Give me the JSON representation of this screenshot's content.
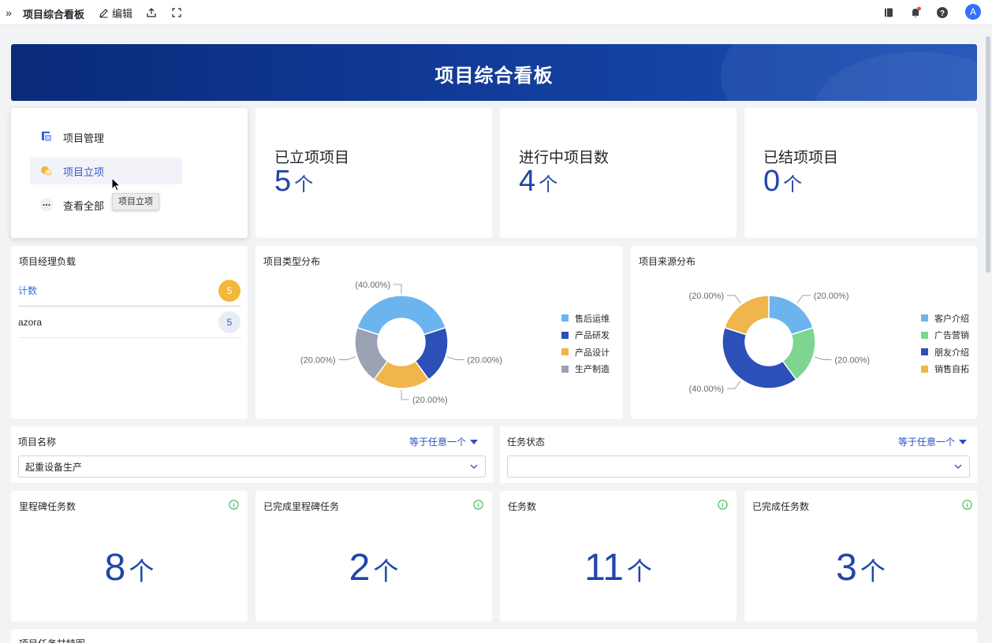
{
  "topbar": {
    "title": "项目综合看板",
    "edit_label": "编辑",
    "avatar_letter": "A"
  },
  "banner": {
    "title": "项目综合看板"
  },
  "nav": {
    "items": [
      {
        "label": "项目管理",
        "icon": "project-manage-icon"
      },
      {
        "label": "项目立项",
        "icon": "project-initiate-icon"
      },
      {
        "label": "查看全部",
        "icon": "more-icon"
      }
    ],
    "tooltip": "项目立项"
  },
  "stats": [
    {
      "label": "已立项项目",
      "value": "5",
      "unit": "个"
    },
    {
      "label": "进行中项目数",
      "value": "4",
      "unit": "个"
    },
    {
      "label": "已结项项目",
      "value": "0",
      "unit": "个"
    }
  ],
  "manager_load": {
    "title": "项目经理负载",
    "rows": [
      {
        "name": "计数",
        "count": "5"
      },
      {
        "name": "azora",
        "count": "5"
      }
    ]
  },
  "type_dist": {
    "title": "项目类型分布"
  },
  "source_dist": {
    "title": "项目来源分布"
  },
  "chart_data": [
    {
      "type": "pie",
      "title": "项目类型分布",
      "categories": [
        "售后运维",
        "产品研发",
        "产品设计",
        "生产制造"
      ],
      "values": [
        40,
        20,
        20,
        20
      ],
      "labels": [
        "(40.00%)",
        "(20.00%)",
        "(20.00%)",
        "(20.00%)"
      ],
      "colors": [
        "#6cb4ee",
        "#2c4fb8",
        "#f0b54c",
        "#9aa2b4"
      ],
      "legend": "right",
      "donut": true
    },
    {
      "type": "pie",
      "title": "项目来源分布",
      "categories": [
        "客户介绍",
        "广告营销",
        "朋友介绍",
        "销售自拓"
      ],
      "values": [
        20,
        20,
        40,
        20
      ],
      "labels": [
        "(20.00%)",
        "(20.00%)",
        "(40.00%)",
        "(20.00%)"
      ],
      "colors": [
        "#6cb4ee",
        "#7dd58f",
        "#2c4fb8",
        "#f0b54c"
      ],
      "legend": "right",
      "donut": true
    }
  ],
  "filters": [
    {
      "label": "项目名称",
      "operator": "等于任意一个",
      "value": "起重设备生产"
    },
    {
      "label": "任务状态",
      "operator": "等于任意一个",
      "value": ""
    }
  ],
  "kpis": [
    {
      "label": "里程碑任务数",
      "value": "8",
      "unit": "个"
    },
    {
      "label": "已完成里程碑任务",
      "value": "2",
      "unit": "个"
    },
    {
      "label": "任务数",
      "value": "11",
      "unit": "个"
    },
    {
      "label": "已完成任务数",
      "value": "3",
      "unit": "个"
    }
  ],
  "gantt": {
    "title": "项目任务甘特图"
  }
}
